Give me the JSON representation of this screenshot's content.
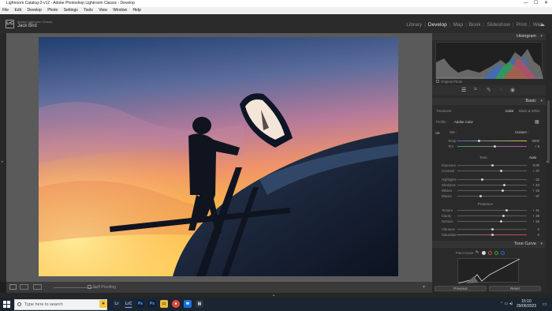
{
  "window": {
    "title": "Lightroom Catalog-2-v12 - Adobe Photoshop Lightroom Classic - Develop"
  },
  "menu": [
    "File",
    "Edit",
    "Develop",
    "Photo",
    "Settings",
    "Tools",
    "View",
    "Window",
    "Help"
  ],
  "identity": {
    "logo": "LrC",
    "subtitle": "Adobe Lightroom Classic",
    "name": "Jack Bird"
  },
  "modules": [
    "Library",
    "Develop",
    "Map",
    "Book",
    "Slideshow",
    "Print",
    "Web"
  ],
  "active_module": "Develop",
  "panels": {
    "histogram": "Histogram",
    "original_photo": "Original Photo",
    "basic": "Basic",
    "tone_curve": "Tone Curve"
  },
  "basic": {
    "treatment_label": "Treatment :",
    "treatment_color": "Color",
    "treatment_bw": "Black & White",
    "profile_label": "Profile :",
    "profile_value": "Adobe Color",
    "wb_label": "WB :",
    "wb_value": "Custom :",
    "temp_label": "Temp",
    "temp_value": "5000",
    "tint_label": "Tint",
    "tint_value": "+ 8",
    "tone_label": "Tone",
    "auto_label": "Auto",
    "exposure_label": "Exposure",
    "exposure_value": "0.00",
    "contrast_label": "Contrast",
    "contrast_value": "+ 37",
    "highlights_label": "Highlights",
    "highlights_value": "- 32",
    "shadows_label": "Shadows",
    "shadows_value": "+ 43",
    "whites_label": "Whites",
    "whites_value": "+ 33",
    "blacks_label": "Blacks",
    "blacks_value": "- 37",
    "presence_label": "Presence",
    "texture_label": "Texture",
    "texture_value": "+ 41",
    "clarity_label": "Clarity",
    "clarity_value": "+ 30",
    "dehaze_label": "Dehaze",
    "dehaze_value": "+ 26",
    "vibrance_label": "Vibrance",
    "vibrance_value": "0",
    "saturation_label": "Saturation",
    "saturation_value": "0"
  },
  "tone_curve": {
    "region_label": "Point Curve :"
  },
  "buttons": {
    "previous": "Previous",
    "reset": "Reset"
  },
  "toolbar": {
    "soft_proofing": "Soft Proofing"
  },
  "taskbar": {
    "search_placeholder": "Type here to search",
    "time": "15:10",
    "date": "29/06/2023"
  },
  "colors": {
    "accent": "#e6e6e6",
    "taskbar": "#1b2530",
    "panel": "#2a2a2a"
  }
}
